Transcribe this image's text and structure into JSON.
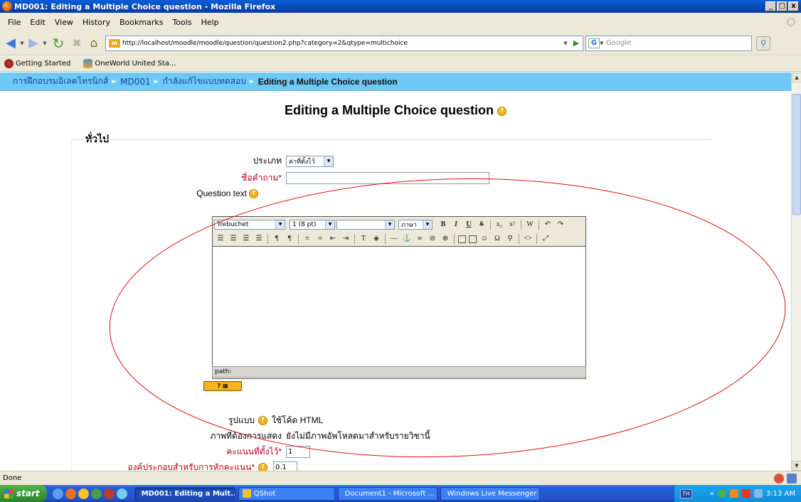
{
  "window": {
    "title": "MD001: Editing a Multiple Choice question - Mozilla Firefox",
    "btn_min": "_",
    "btn_max": "□",
    "btn_close": "x"
  },
  "menu": [
    "File",
    "Edit",
    "View",
    "History",
    "Bookmarks",
    "Tools",
    "Help"
  ],
  "navbar": {
    "url": "http://localhost/moodle/moodle/question/question2.php?category=2&qtype=multichoice",
    "search_placeholder": "Google",
    "site_icon": "m"
  },
  "bookmarks": [
    {
      "label": "Getting Started",
      "icon": "getting-started-icon"
    },
    {
      "label": "OneWorld United Sta...",
      "icon": "oneworld-icon"
    }
  ],
  "breadcrumb": {
    "item1": "การฝึกอบรมอิเลคโทรนิกส์",
    "item2": "MD001",
    "item3": "กำลังแก้ไขแบบทดสอบ",
    "current": "Editing a Multiple Choice question"
  },
  "page": {
    "heading": "Editing a Multiple Choice question",
    "section": "ทั่วไป",
    "category_label": "ประเภท",
    "category_value": "ค่าที่ตั้งไว้",
    "name_label": "ชื่อคำถาม",
    "name_value": "",
    "question_text_label": "Question text",
    "format_label": "รูปแบบ",
    "format_value": "ใช้โค้ด HTML",
    "image_label": "ภาพที่ต้องการแสดง",
    "image_value": "ยังไม่มีภาพอัพโหลดมาสำหรับรายวิชานี้",
    "grade_label": "คะแนนที่ตั้งไว้",
    "grade_value": "1",
    "penalty_label": "องค์ประกอบสำหรับการหักคะแนน",
    "penalty_value": "0.1",
    "required_mark": "*"
  },
  "editor": {
    "font": "Trebuchet",
    "size": "1 (8 pt)",
    "style": "",
    "lang": "ภาษา",
    "path": "path:",
    "help_label": "?"
  },
  "status": {
    "text": "Done"
  },
  "taskbar": {
    "start": "start",
    "tasks": [
      {
        "label": "MD001: Editing a Mult...",
        "active": true
      },
      {
        "label": "QShot",
        "active": false
      },
      {
        "label": "Document1 - Microsoft ...",
        "active": false
      },
      {
        "label": "Windows Live Messenger",
        "active": false
      }
    ],
    "lang": "TH",
    "clock": "3:13 AM"
  }
}
